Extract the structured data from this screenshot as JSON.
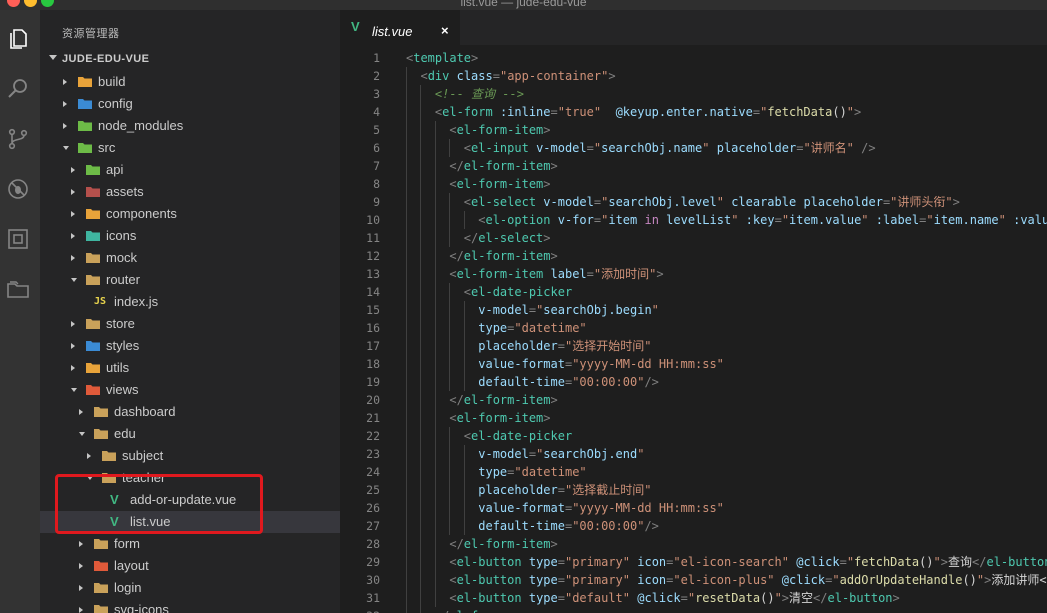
{
  "window": {
    "title": "list.vue — jude-edu-vue"
  },
  "sidebar": {
    "title": "资源管理器",
    "project": "JUDE-EDU-VUE",
    "items": [
      {
        "label": "build",
        "type": "folder",
        "state": "closed",
        "depth": 0,
        "color": "#e8a33a"
      },
      {
        "label": "config",
        "type": "folder",
        "state": "closed",
        "depth": 0,
        "color": "#3b8bd4"
      },
      {
        "label": "node_modules",
        "type": "folder",
        "state": "closed",
        "depth": 0,
        "color": "#6dbb47"
      },
      {
        "label": "src",
        "type": "folder",
        "state": "open",
        "depth": 0,
        "color": "#6dbb47"
      },
      {
        "label": "api",
        "type": "folder",
        "state": "closed",
        "depth": 1,
        "color": "#6dbb47"
      },
      {
        "label": "assets",
        "type": "folder",
        "state": "closed",
        "depth": 1,
        "color": "#b5504c"
      },
      {
        "label": "components",
        "type": "folder",
        "state": "closed",
        "depth": 1,
        "color": "#e8a33a"
      },
      {
        "label": "icons",
        "type": "folder",
        "state": "closed",
        "depth": 1,
        "color": "#3fb5a0"
      },
      {
        "label": "mock",
        "type": "folder",
        "state": "closed",
        "depth": 1,
        "color": "#c9a15a"
      },
      {
        "label": "router",
        "type": "folder",
        "state": "open",
        "depth": 1,
        "color": "#c9a15a"
      },
      {
        "label": "index.js",
        "type": "js",
        "state": "none",
        "depth": 2
      },
      {
        "label": "store",
        "type": "folder",
        "state": "closed",
        "depth": 1,
        "color": "#c9a15a"
      },
      {
        "label": "styles",
        "type": "folder",
        "state": "closed",
        "depth": 1,
        "color": "#3b8bd4"
      },
      {
        "label": "utils",
        "type": "folder",
        "state": "closed",
        "depth": 1,
        "color": "#e8a33a"
      },
      {
        "label": "views",
        "type": "folder",
        "state": "open",
        "depth": 1,
        "color": "#e05a3a"
      },
      {
        "label": "dashboard",
        "type": "folder",
        "state": "closed",
        "depth": 2,
        "color": "#c9a15a"
      },
      {
        "label": "edu",
        "type": "folder",
        "state": "open",
        "depth": 2,
        "color": "#c9a15a"
      },
      {
        "label": "subject",
        "type": "folder",
        "state": "closed",
        "depth": 3,
        "color": "#c9a15a"
      },
      {
        "label": "teacher",
        "type": "folder",
        "state": "open",
        "depth": 3,
        "color": "#c9a15a"
      },
      {
        "label": "add-or-update.vue",
        "type": "vue",
        "state": "none",
        "depth": 4
      },
      {
        "label": "list.vue",
        "type": "vue",
        "state": "none",
        "depth": 4,
        "selected": true
      },
      {
        "label": "form",
        "type": "folder",
        "state": "closed",
        "depth": 2,
        "color": "#c9a15a"
      },
      {
        "label": "layout",
        "type": "folder",
        "state": "closed",
        "depth": 2,
        "color": "#e05a3a"
      },
      {
        "label": "login",
        "type": "folder",
        "state": "closed",
        "depth": 2,
        "color": "#c9a15a"
      },
      {
        "label": "svg-icons",
        "type": "folder",
        "state": "closed",
        "depth": 2,
        "color": "#c9a15a"
      }
    ]
  },
  "tabs": [
    {
      "label": "list.vue",
      "close": "×",
      "icon": "vue-icon"
    }
  ],
  "editor": {
    "lines": [
      [
        [
          "tok-punct",
          "<"
        ],
        [
          "tok-tag",
          "template"
        ],
        [
          "tok-punct",
          ">"
        ]
      ],
      [
        [
          "tok-punct",
          "  <"
        ],
        [
          "tok-tag",
          "div"
        ],
        [
          "tok-plain",
          " "
        ],
        [
          "tok-attr",
          "class"
        ],
        [
          "tok-punct",
          "="
        ],
        [
          "tok-str",
          "\"app-container\""
        ],
        [
          "tok-punct",
          ">"
        ]
      ],
      [
        [
          "tok-comment",
          "    <!-- 查询 -->"
        ]
      ],
      [
        [
          "tok-punct",
          "    <"
        ],
        [
          "tok-tag",
          "el-form"
        ],
        [
          "tok-plain",
          " "
        ],
        [
          "tok-attr",
          ":inline"
        ],
        [
          "tok-punct",
          "="
        ],
        [
          "tok-str",
          "\"true\""
        ],
        [
          "tok-plain",
          "  "
        ],
        [
          "tok-attr",
          "@keyup.enter.native"
        ],
        [
          "tok-punct",
          "="
        ],
        [
          "tok-str",
          "\""
        ],
        [
          "tok-fn",
          "fetchData"
        ],
        [
          "tok-plain",
          "()"
        ],
        [
          "tok-str",
          "\""
        ],
        [
          "tok-punct",
          ">"
        ]
      ],
      [
        [
          "tok-punct",
          "      <"
        ],
        [
          "tok-tag",
          "el-form-item"
        ],
        [
          "tok-punct",
          ">"
        ]
      ],
      [
        [
          "tok-punct",
          "        <"
        ],
        [
          "tok-tag",
          "el-input"
        ],
        [
          "tok-plain",
          " "
        ],
        [
          "tok-attr",
          "v-model"
        ],
        [
          "tok-punct",
          "="
        ],
        [
          "tok-str",
          "\""
        ],
        [
          "tok-attr",
          "searchObj.name"
        ],
        [
          "tok-str",
          "\""
        ],
        [
          "tok-plain",
          " "
        ],
        [
          "tok-attr",
          "placeholder"
        ],
        [
          "tok-punct",
          "="
        ],
        [
          "tok-str",
          "\"讲师名\""
        ],
        [
          "tok-plain",
          " "
        ],
        [
          "tok-punct",
          "/>"
        ]
      ],
      [
        [
          "tok-punct",
          "      </"
        ],
        [
          "tok-tag",
          "el-form-item"
        ],
        [
          "tok-punct",
          ">"
        ]
      ],
      [
        [
          "tok-punct",
          "      <"
        ],
        [
          "tok-tag",
          "el-form-item"
        ],
        [
          "tok-punct",
          ">"
        ]
      ],
      [
        [
          "tok-punct",
          "        <"
        ],
        [
          "tok-tag",
          "el-select"
        ],
        [
          "tok-plain",
          " "
        ],
        [
          "tok-attr",
          "v-model"
        ],
        [
          "tok-punct",
          "="
        ],
        [
          "tok-str",
          "\""
        ],
        [
          "tok-attr",
          "searchObj.level"
        ],
        [
          "tok-str",
          "\""
        ],
        [
          "tok-plain",
          " "
        ],
        [
          "tok-attr",
          "clearable"
        ],
        [
          "tok-plain",
          " "
        ],
        [
          "tok-attr",
          "placeholder"
        ],
        [
          "tok-punct",
          "="
        ],
        [
          "tok-str",
          "\"讲师头衔\""
        ],
        [
          "tok-punct",
          ">"
        ]
      ],
      [
        [
          "tok-punct",
          "          <"
        ],
        [
          "tok-tag",
          "el-option"
        ],
        [
          "tok-plain",
          " "
        ],
        [
          "tok-attr",
          "v-for"
        ],
        [
          "tok-punct",
          "="
        ],
        [
          "tok-str",
          "\""
        ],
        [
          "tok-attr",
          "item"
        ],
        [
          "tok-plain",
          " "
        ],
        [
          "tok-kw",
          "in"
        ],
        [
          "tok-plain",
          " "
        ],
        [
          "tok-attr",
          "levelList"
        ],
        [
          "tok-str",
          "\""
        ],
        [
          "tok-plain",
          " "
        ],
        [
          "tok-attr",
          ":key"
        ],
        [
          "tok-punct",
          "="
        ],
        [
          "tok-str",
          "\""
        ],
        [
          "tok-attr",
          "item.value"
        ],
        [
          "tok-str",
          "\""
        ],
        [
          "tok-plain",
          " "
        ],
        [
          "tok-attr",
          ":label"
        ],
        [
          "tok-punct",
          "="
        ],
        [
          "tok-str",
          "\""
        ],
        [
          "tok-attr",
          "item.name"
        ],
        [
          "tok-str",
          "\""
        ],
        [
          "tok-plain",
          " "
        ],
        [
          "tok-attr",
          ":valu"
        ]
      ],
      [
        [
          "tok-punct",
          "        </"
        ],
        [
          "tok-tag",
          "el-select"
        ],
        [
          "tok-punct",
          ">"
        ]
      ],
      [
        [
          "tok-punct",
          "      </"
        ],
        [
          "tok-tag",
          "el-form-item"
        ],
        [
          "tok-punct",
          ">"
        ]
      ],
      [
        [
          "tok-punct",
          "      <"
        ],
        [
          "tok-tag",
          "el-form-item"
        ],
        [
          "tok-plain",
          " "
        ],
        [
          "tok-attr",
          "label"
        ],
        [
          "tok-punct",
          "="
        ],
        [
          "tok-str",
          "\"添加时间\""
        ],
        [
          "tok-punct",
          ">"
        ]
      ],
      [
        [
          "tok-punct",
          "        <"
        ],
        [
          "tok-tag",
          "el-date-picker"
        ]
      ],
      [
        [
          "tok-plain",
          "          "
        ],
        [
          "tok-attr",
          "v-model"
        ],
        [
          "tok-punct",
          "="
        ],
        [
          "tok-str",
          "\""
        ],
        [
          "tok-attr",
          "searchObj.begin"
        ],
        [
          "tok-str",
          "\""
        ]
      ],
      [
        [
          "tok-plain",
          "          "
        ],
        [
          "tok-attr",
          "type"
        ],
        [
          "tok-punct",
          "="
        ],
        [
          "tok-str",
          "\"datetime\""
        ]
      ],
      [
        [
          "tok-plain",
          "          "
        ],
        [
          "tok-attr",
          "placeholder"
        ],
        [
          "tok-punct",
          "="
        ],
        [
          "tok-str",
          "\"选择开始时间\""
        ]
      ],
      [
        [
          "tok-plain",
          "          "
        ],
        [
          "tok-attr",
          "value-format"
        ],
        [
          "tok-punct",
          "="
        ],
        [
          "tok-str",
          "\"yyyy-MM-dd HH:mm:ss\""
        ]
      ],
      [
        [
          "tok-plain",
          "          "
        ],
        [
          "tok-attr",
          "default-time"
        ],
        [
          "tok-punct",
          "="
        ],
        [
          "tok-str",
          "\"00:00:00\""
        ],
        [
          "tok-punct",
          "/>"
        ]
      ],
      [
        [
          "tok-punct",
          "      </"
        ],
        [
          "tok-tag",
          "el-form-item"
        ],
        [
          "tok-punct",
          ">"
        ]
      ],
      [
        [
          "tok-punct",
          "      <"
        ],
        [
          "tok-tag",
          "el-form-item"
        ],
        [
          "tok-punct",
          ">"
        ]
      ],
      [
        [
          "tok-punct",
          "        <"
        ],
        [
          "tok-tag",
          "el-date-picker"
        ]
      ],
      [
        [
          "tok-plain",
          "          "
        ],
        [
          "tok-attr",
          "v-model"
        ],
        [
          "tok-punct",
          "="
        ],
        [
          "tok-str",
          "\""
        ],
        [
          "tok-attr",
          "searchObj.end"
        ],
        [
          "tok-str",
          "\""
        ]
      ],
      [
        [
          "tok-plain",
          "          "
        ],
        [
          "tok-attr",
          "type"
        ],
        [
          "tok-punct",
          "="
        ],
        [
          "tok-str",
          "\"datetime\""
        ]
      ],
      [
        [
          "tok-plain",
          "          "
        ],
        [
          "tok-attr",
          "placeholder"
        ],
        [
          "tok-punct",
          "="
        ],
        [
          "tok-str",
          "\"选择截止时间\""
        ]
      ],
      [
        [
          "tok-plain",
          "          "
        ],
        [
          "tok-attr",
          "value-format"
        ],
        [
          "tok-punct",
          "="
        ],
        [
          "tok-str",
          "\"yyyy-MM-dd HH:mm:ss\""
        ]
      ],
      [
        [
          "tok-plain",
          "          "
        ],
        [
          "tok-attr",
          "default-time"
        ],
        [
          "tok-punct",
          "="
        ],
        [
          "tok-str",
          "\"00:00:00\""
        ],
        [
          "tok-punct",
          "/>"
        ]
      ],
      [
        [
          "tok-punct",
          "      </"
        ],
        [
          "tok-tag",
          "el-form-item"
        ],
        [
          "tok-punct",
          ">"
        ]
      ],
      [
        [
          "tok-punct",
          "      <"
        ],
        [
          "tok-tag",
          "el-button"
        ],
        [
          "tok-plain",
          " "
        ],
        [
          "tok-attr",
          "type"
        ],
        [
          "tok-punct",
          "="
        ],
        [
          "tok-str",
          "\"primary\""
        ],
        [
          "tok-plain",
          " "
        ],
        [
          "tok-attr",
          "icon"
        ],
        [
          "tok-punct",
          "="
        ],
        [
          "tok-str",
          "\"el-icon-search\""
        ],
        [
          "tok-plain",
          " "
        ],
        [
          "tok-attr",
          "@click"
        ],
        [
          "tok-punct",
          "="
        ],
        [
          "tok-str",
          "\""
        ],
        [
          "tok-fn",
          "fetchData"
        ],
        [
          "tok-plain",
          "()"
        ],
        [
          "tok-str",
          "\""
        ],
        [
          "tok-punct",
          ">"
        ],
        [
          "tok-text",
          "查询"
        ],
        [
          "tok-punct",
          "</"
        ],
        [
          "tok-tag",
          "el-button"
        ]
      ],
      [
        [
          "tok-punct",
          "      <"
        ],
        [
          "tok-tag",
          "el-button"
        ],
        [
          "tok-plain",
          " "
        ],
        [
          "tok-attr",
          "type"
        ],
        [
          "tok-punct",
          "="
        ],
        [
          "tok-str",
          "\"primary\""
        ],
        [
          "tok-plain",
          " "
        ],
        [
          "tok-attr",
          "icon"
        ],
        [
          "tok-punct",
          "="
        ],
        [
          "tok-str",
          "\"el-icon-plus\""
        ],
        [
          "tok-plain",
          " "
        ],
        [
          "tok-attr",
          "@click"
        ],
        [
          "tok-punct",
          "="
        ],
        [
          "tok-str",
          "\""
        ],
        [
          "tok-fn",
          "addOrUpdateHandle"
        ],
        [
          "tok-plain",
          "()"
        ],
        [
          "tok-str",
          "\""
        ],
        [
          "tok-punct",
          ">"
        ],
        [
          "tok-text",
          "添加讲师<"
        ]
      ],
      [
        [
          "tok-punct",
          "      <"
        ],
        [
          "tok-tag",
          "el-button"
        ],
        [
          "tok-plain",
          " "
        ],
        [
          "tok-attr",
          "type"
        ],
        [
          "tok-punct",
          "="
        ],
        [
          "tok-str",
          "\"default\""
        ],
        [
          "tok-plain",
          " "
        ],
        [
          "tok-attr",
          "@click"
        ],
        [
          "tok-punct",
          "="
        ],
        [
          "tok-str",
          "\""
        ],
        [
          "tok-fn",
          "resetData"
        ],
        [
          "tok-plain",
          "()"
        ],
        [
          "tok-str",
          "\""
        ],
        [
          "tok-punct",
          ">"
        ],
        [
          "tok-text",
          "清空"
        ],
        [
          "tok-punct",
          "</"
        ],
        [
          "tok-tag",
          "el-button"
        ],
        [
          "tok-punct",
          ">"
        ]
      ],
      [
        [
          "tok-punct",
          "    </"
        ],
        [
          "tok-tag",
          "el-form"
        ],
        [
          "tok-punct",
          ">"
        ]
      ]
    ]
  },
  "colors": {
    "highlight": "#e0191e",
    "vue": "#41b883"
  }
}
